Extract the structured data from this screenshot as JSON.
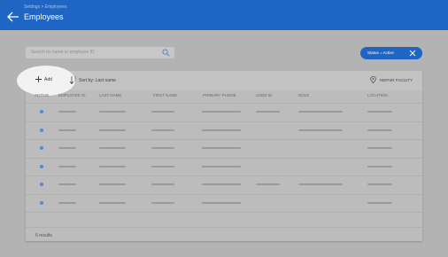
{
  "header": {
    "breadcrumb": "Settings > Employees",
    "title": "Employees",
    "back_icon": "arrow-left-icon",
    "color": "#1f66c4"
  },
  "search": {
    "placeholder": "Search by name or employee ID",
    "icon": "search-icon"
  },
  "filter_chip": {
    "label": "Status = Active",
    "close_icon": "close-icon"
  },
  "toolbar": {
    "add_label": "Add",
    "add_icon": "plus-icon",
    "sort_label": "Sort by: Last name",
    "sort_icon": "sort-icon",
    "repair_label": "REPAIR FACILITY",
    "repair_icon": "location-pin-icon"
  },
  "table": {
    "columns": [
      "ACTIVE",
      "EMPLOYEE ID",
      "LAST NAME",
      "FIRST NAME",
      "PRIMARY PHONE",
      "USER ID",
      "ROLE",
      "LOCATION"
    ],
    "rows": [
      {
        "active": true,
        "employee_id": "",
        "last_name": "",
        "first_name": "",
        "primary_phone": "",
        "user_id": "",
        "role": "",
        "location": ""
      },
      {
        "active": true,
        "employee_id": "",
        "last_name": "",
        "first_name": "",
        "primary_phone": "",
        "user_id": "",
        "role": "",
        "location": ""
      },
      {
        "active": true,
        "employee_id": "",
        "last_name": "",
        "first_name": "",
        "primary_phone": "",
        "user_id": "",
        "role": "",
        "location": ""
      },
      {
        "active": true,
        "employee_id": "",
        "last_name": "",
        "first_name": "",
        "primary_phone": "",
        "user_id": "",
        "role": "",
        "location": ""
      },
      {
        "active": true,
        "employee_id": "",
        "last_name": "",
        "first_name": "",
        "primary_phone": "",
        "user_id": "",
        "role": "",
        "location": ""
      },
      {
        "active": true,
        "employee_id": "",
        "last_name": "",
        "first_name": "",
        "primary_phone": "",
        "user_id": "",
        "role": "",
        "location": ""
      }
    ],
    "active_color": "#4d8ad8"
  },
  "footer": {
    "results": "6 results"
  }
}
